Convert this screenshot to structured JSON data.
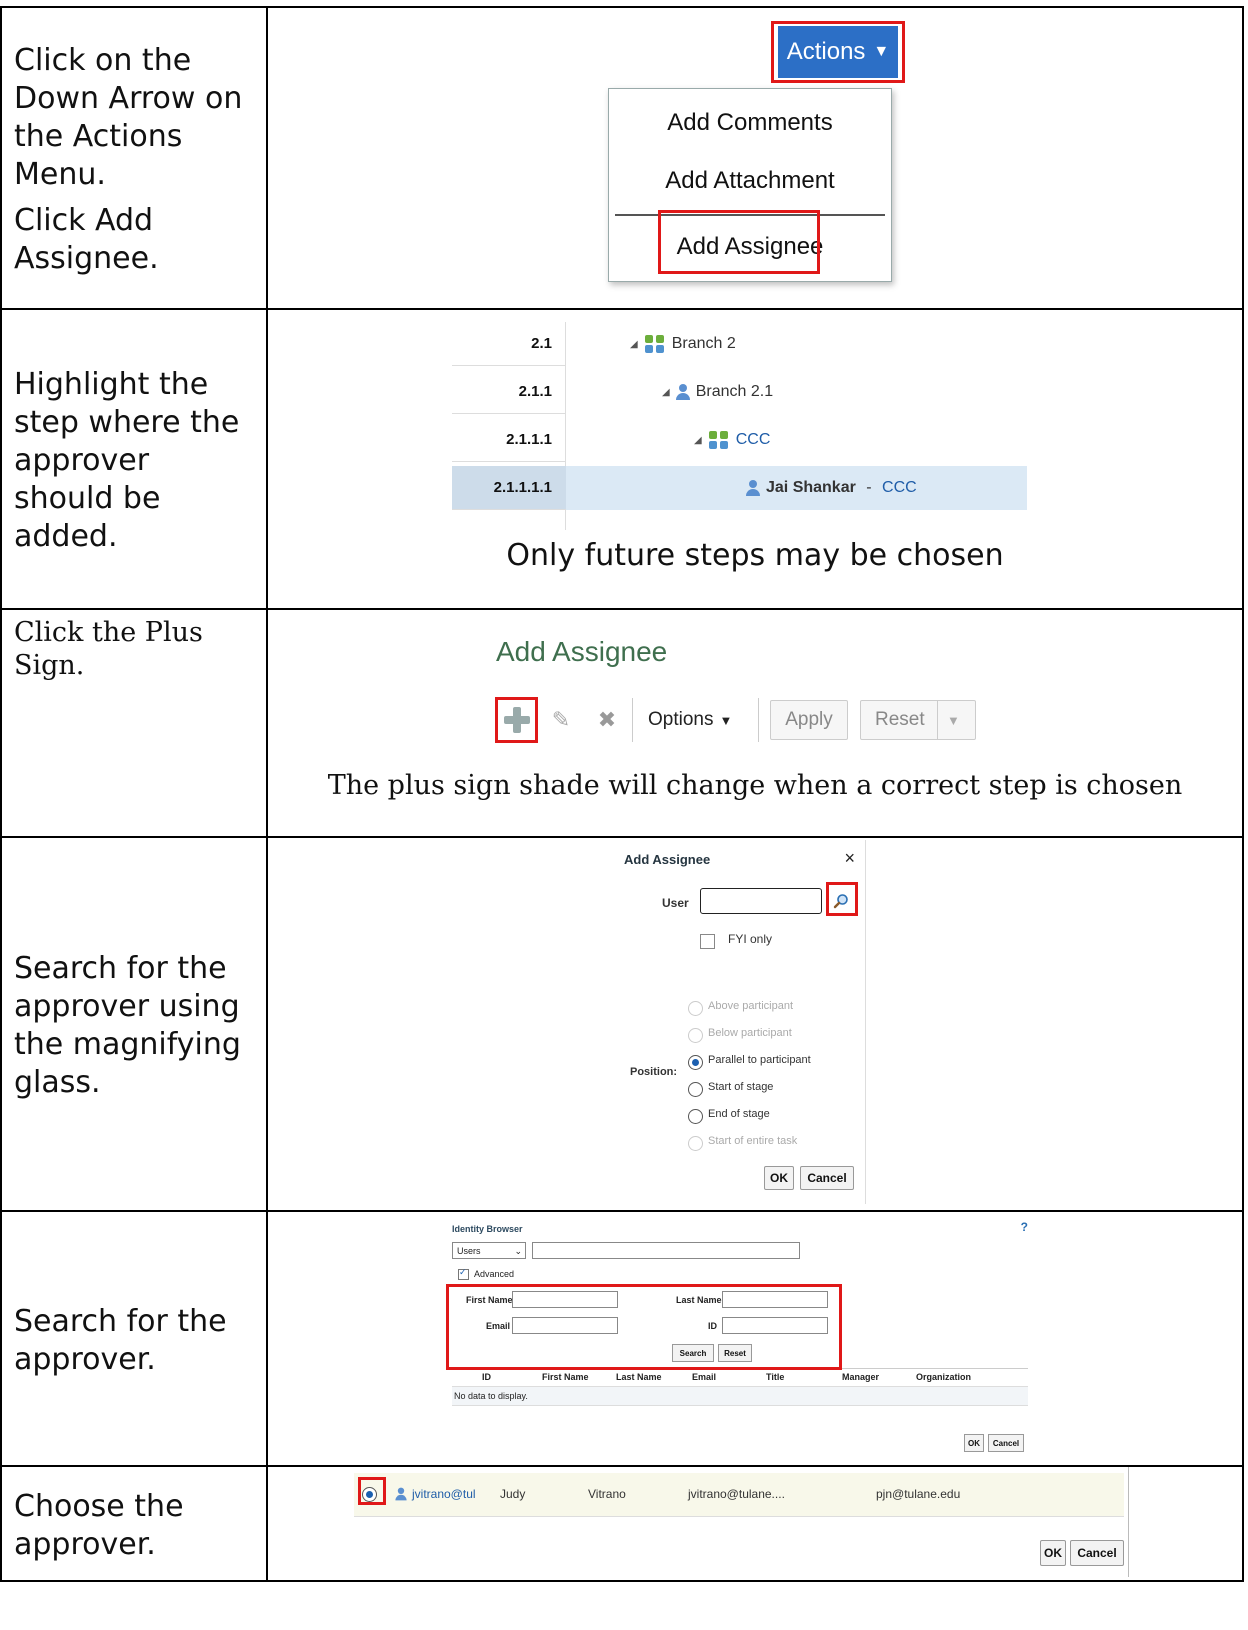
{
  "rows": [
    {
      "instruction_lines": [
        "Click on the Down Arrow on the Actions Menu.",
        "Click Add Assignee."
      ],
      "actions_menu": {
        "button_label": "Actions",
        "items": [
          "Add Comments",
          "Add Attachment",
          "Add Assignee"
        ]
      }
    },
    {
      "instruction": "Highlight the step where the approver should be added.",
      "tree": [
        {
          "num": "2.1",
          "label": "Branch 2",
          "icon": "group-icon"
        },
        {
          "num": "2.1.1",
          "label": "Branch 2.1",
          "icon": "person-icon"
        },
        {
          "num": "2.1.1.1",
          "label": "CCC",
          "icon": "group-icon"
        },
        {
          "num": "2.1.1.1.1",
          "label_name": "Jai Shankar",
          "label_sep": " - ",
          "label_group": "CCC",
          "icon": "person-icon",
          "selected": true
        }
      ],
      "caption": "Only future steps may be chosen"
    },
    {
      "instruction": "Click the Plus Sign.",
      "panel_title": "Add Assignee",
      "toolbar": {
        "options_label": "Options",
        "apply_label": "Apply",
        "reset_label": "Reset"
      },
      "caption": "The plus sign shade will change when a correct step is chosen"
    },
    {
      "instruction": "Search for the approver using the magnifying glass.",
      "dialog": {
        "title": "Add Assignee",
        "close": "×",
        "user_label": "User",
        "fyi_label": "FYI only",
        "position_label": "Position:",
        "options": [
          {
            "label": "Above participant",
            "state": "disabled"
          },
          {
            "label": "Below participant",
            "state": "disabled"
          },
          {
            "label": "Parallel to participant",
            "state": "selected"
          },
          {
            "label": "Start of stage",
            "state": "enabled"
          },
          {
            "label": "End of stage",
            "state": "enabled"
          },
          {
            "label": "Start of entire task",
            "state": "disabled"
          }
        ],
        "ok_label": "OK",
        "cancel_label": "Cancel"
      }
    },
    {
      "instruction": "Search for the approver.",
      "identity_browser": {
        "title": "Identity Browser",
        "type_select": "Users",
        "advanced_label": "Advanced",
        "first_name_label": "First Name",
        "last_name_label": "Last Name",
        "email_label": "Email",
        "id_label": "ID",
        "search_label": "Search",
        "reset_label": "Reset",
        "columns": [
          "ID",
          "First Name",
          "Last Name",
          "Email",
          "Title",
          "Manager",
          "Organization"
        ],
        "empty_text": "No data to display.",
        "ok_label": "OK",
        "cancel_label": "Cancel"
      }
    },
    {
      "instruction": "Choose the approver.",
      "result": {
        "id": "jvitrano@tul",
        "first_name": "Judy",
        "last_name": "Vitrano",
        "email": "jvitrano@tulane....",
        "manager": "pjn@tulane.edu"
      },
      "ok_label": "OK",
      "cancel_label": "Cancel"
    }
  ],
  "colors": {
    "highlight_box": "#e01818",
    "actions_button": "#2c6fc6",
    "selected_row": "#dbe9f5"
  }
}
